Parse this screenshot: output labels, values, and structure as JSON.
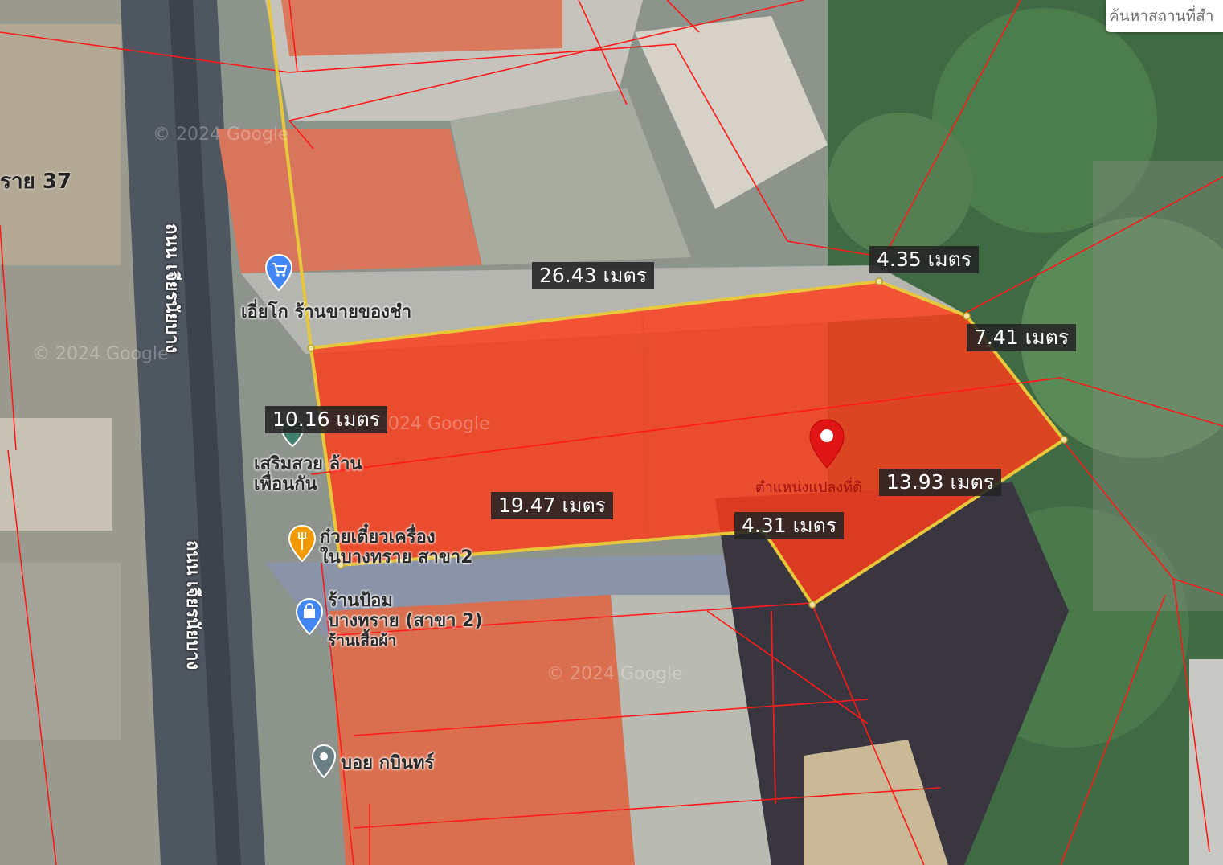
{
  "search": {
    "placeholder": "ค้นหาสถานที่สำ"
  },
  "measurements": {
    "north_edge": "26.43 เมตร",
    "northeast_edge_a": "4.35 เมตร",
    "northeast_edge_b": "7.41 เมตร",
    "west_edge": "10.16 เมตร",
    "southeast_edge": "13.93 เมตร",
    "south_edge": "19.47 เมตร",
    "south_notch": "4.31 เมตร"
  },
  "parcel": {
    "caption": "ตำแหน่งแปลงที่ดิ",
    "fill_color": "#ff3d1a",
    "outline_color": "#e8c83a"
  },
  "places": {
    "shop_top": {
      "line1": "เอี่ยโก",
      "line2": "ร้านขายของชำ",
      "icon": "shopping-cart-icon"
    },
    "salon": {
      "line1": "เสริมสวย ล้าน",
      "line2": "เพื่อนกัน",
      "icon": "map-pin-icon"
    },
    "noodle": {
      "line1": "ก๋วยเตี๋ยวเครื่อง",
      "line2": "ในบางทราย สาขา2",
      "icon": "restaurant-icon"
    },
    "clothing": {
      "line1": "ร้านป้อม",
      "line2": "บางทราย (สาขา 2)",
      "line3": "ร้านเสื้อผ้า",
      "icon": "shopping-bag-icon"
    },
    "bottom": {
      "line1": "บอย กบินทร์",
      "icon": "map-pin-icon"
    }
  },
  "roads": {
    "left_top": "ราย 37",
    "main_road_a": "ถนน เจียรนัยบาง",
    "main_road_b": "ถนน เจียรนัยบาง"
  },
  "watermark": "© 2024 Google",
  "colors": {
    "boundary_line": "#ff1a1a",
    "label_bg": "#232323",
    "pin": "#e01515"
  }
}
